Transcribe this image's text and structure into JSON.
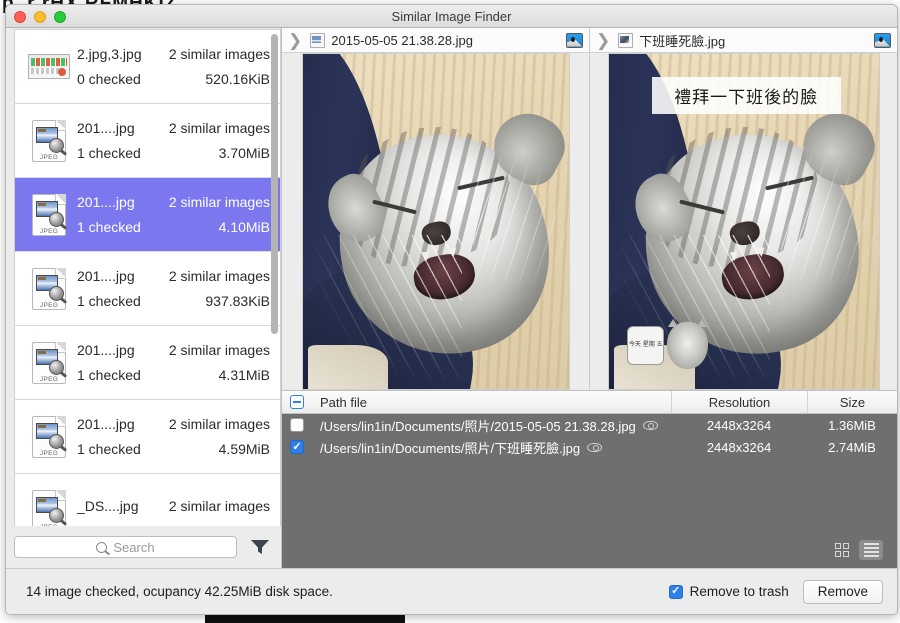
{
  "desktop": {
    "background_text": "p..r rHX RFMHKIZ"
  },
  "window": {
    "title": "Similar Image Finder",
    "traffic_lights": [
      "close-button",
      "minimize-button",
      "zoom-button"
    ]
  },
  "sidebar": {
    "scrollbar": "vertical-scrollbar",
    "groups": [
      {
        "name": "2.jpg,3.jpg",
        "count": "2 similar images",
        "checked": "0 checked",
        "size": "520.16KiB",
        "icon": "photo-thumbnail-icon",
        "selected": false
      },
      {
        "name": "201....jpg",
        "count": "2 similar images",
        "checked": "1 checked",
        "size": "3.70MiB",
        "icon": "jpeg-file-icon",
        "selected": false
      },
      {
        "name": "201....jpg",
        "count": "2 similar images",
        "checked": "1 checked",
        "size": "4.10MiB",
        "icon": "jpeg-file-icon",
        "selected": true
      },
      {
        "name": "201....jpg",
        "count": "2 similar images",
        "checked": "1 checked",
        "size": "937.83KiB",
        "icon": "jpeg-file-icon",
        "selected": false
      },
      {
        "name": "201....jpg",
        "count": "2 similar images",
        "checked": "1 checked",
        "size": "4.31MiB",
        "icon": "jpeg-file-icon",
        "selected": false
      },
      {
        "name": "201....jpg",
        "count": "2 similar images",
        "checked": "1 checked",
        "size": "4.59MiB",
        "icon": "jpeg-file-icon",
        "selected": false
      },
      {
        "name": "_DS....jpg",
        "count": "2 similar images",
        "checked": "",
        "size": "",
        "icon": "jpeg-file-icon",
        "selected": false
      }
    ],
    "search": {
      "placeholder": "Search",
      "value": "",
      "icon": "search-icon"
    },
    "filter_icon": "filter-funnel-icon"
  },
  "previews": [
    {
      "title": "2015-05-05 21.38.28.jpg",
      "chevron": "chevron-right-icon",
      "file_icon": "image-file-icon",
      "reveal_icon": "finder-reveal-icon",
      "photo": {
        "subject": "sleeping tabby cat on dark blue sleeve",
        "overlay_text": ""
      }
    },
    {
      "title": "下班睡死臉.jpg",
      "chevron": "chevron-right-icon",
      "file_icon": "image-file-icon",
      "reveal_icon": "finder-reveal-icon",
      "photo": {
        "subject": "sleeping tabby cat on dark blue sleeve",
        "overlay_text": "禮拜一下班後的臉",
        "sticker_text": "今天\n星期\n五"
      }
    }
  ],
  "file_table": {
    "header_checkbox_state": "mixed",
    "columns": [
      "Path file",
      "Resolution",
      "Size"
    ],
    "rows": [
      {
        "checked": false,
        "path": "/Users/lin1in/Documents/照片/2015-05-05 21.38.28.jpg",
        "resolution": "2448x3264",
        "size": "1.36MiB",
        "preview_icon": "eye-icon"
      },
      {
        "checked": true,
        "path": "/Users/lin1in/Documents/照片/下班睡死臉.jpg",
        "resolution": "2448x3264",
        "size": "2.74MiB",
        "preview_icon": "eye-icon"
      }
    ],
    "view_modes": [
      {
        "name": "grid-view",
        "icon": "grid-view-icon",
        "active": false
      },
      {
        "name": "list-view",
        "icon": "list-view-icon",
        "active": true
      }
    ]
  },
  "footer": {
    "status": "14 image checked, ocupancy 42.25MiB disk space.",
    "remove_to_trash_label": "Remove to trash",
    "remove_to_trash_checked": true,
    "remove_button": "Remove"
  },
  "colors": {
    "selection": "#7b78ef",
    "checkbox_blue": "#2f7fe8",
    "table_background": "#6f6f6f",
    "window_chrome": "#ececec"
  }
}
